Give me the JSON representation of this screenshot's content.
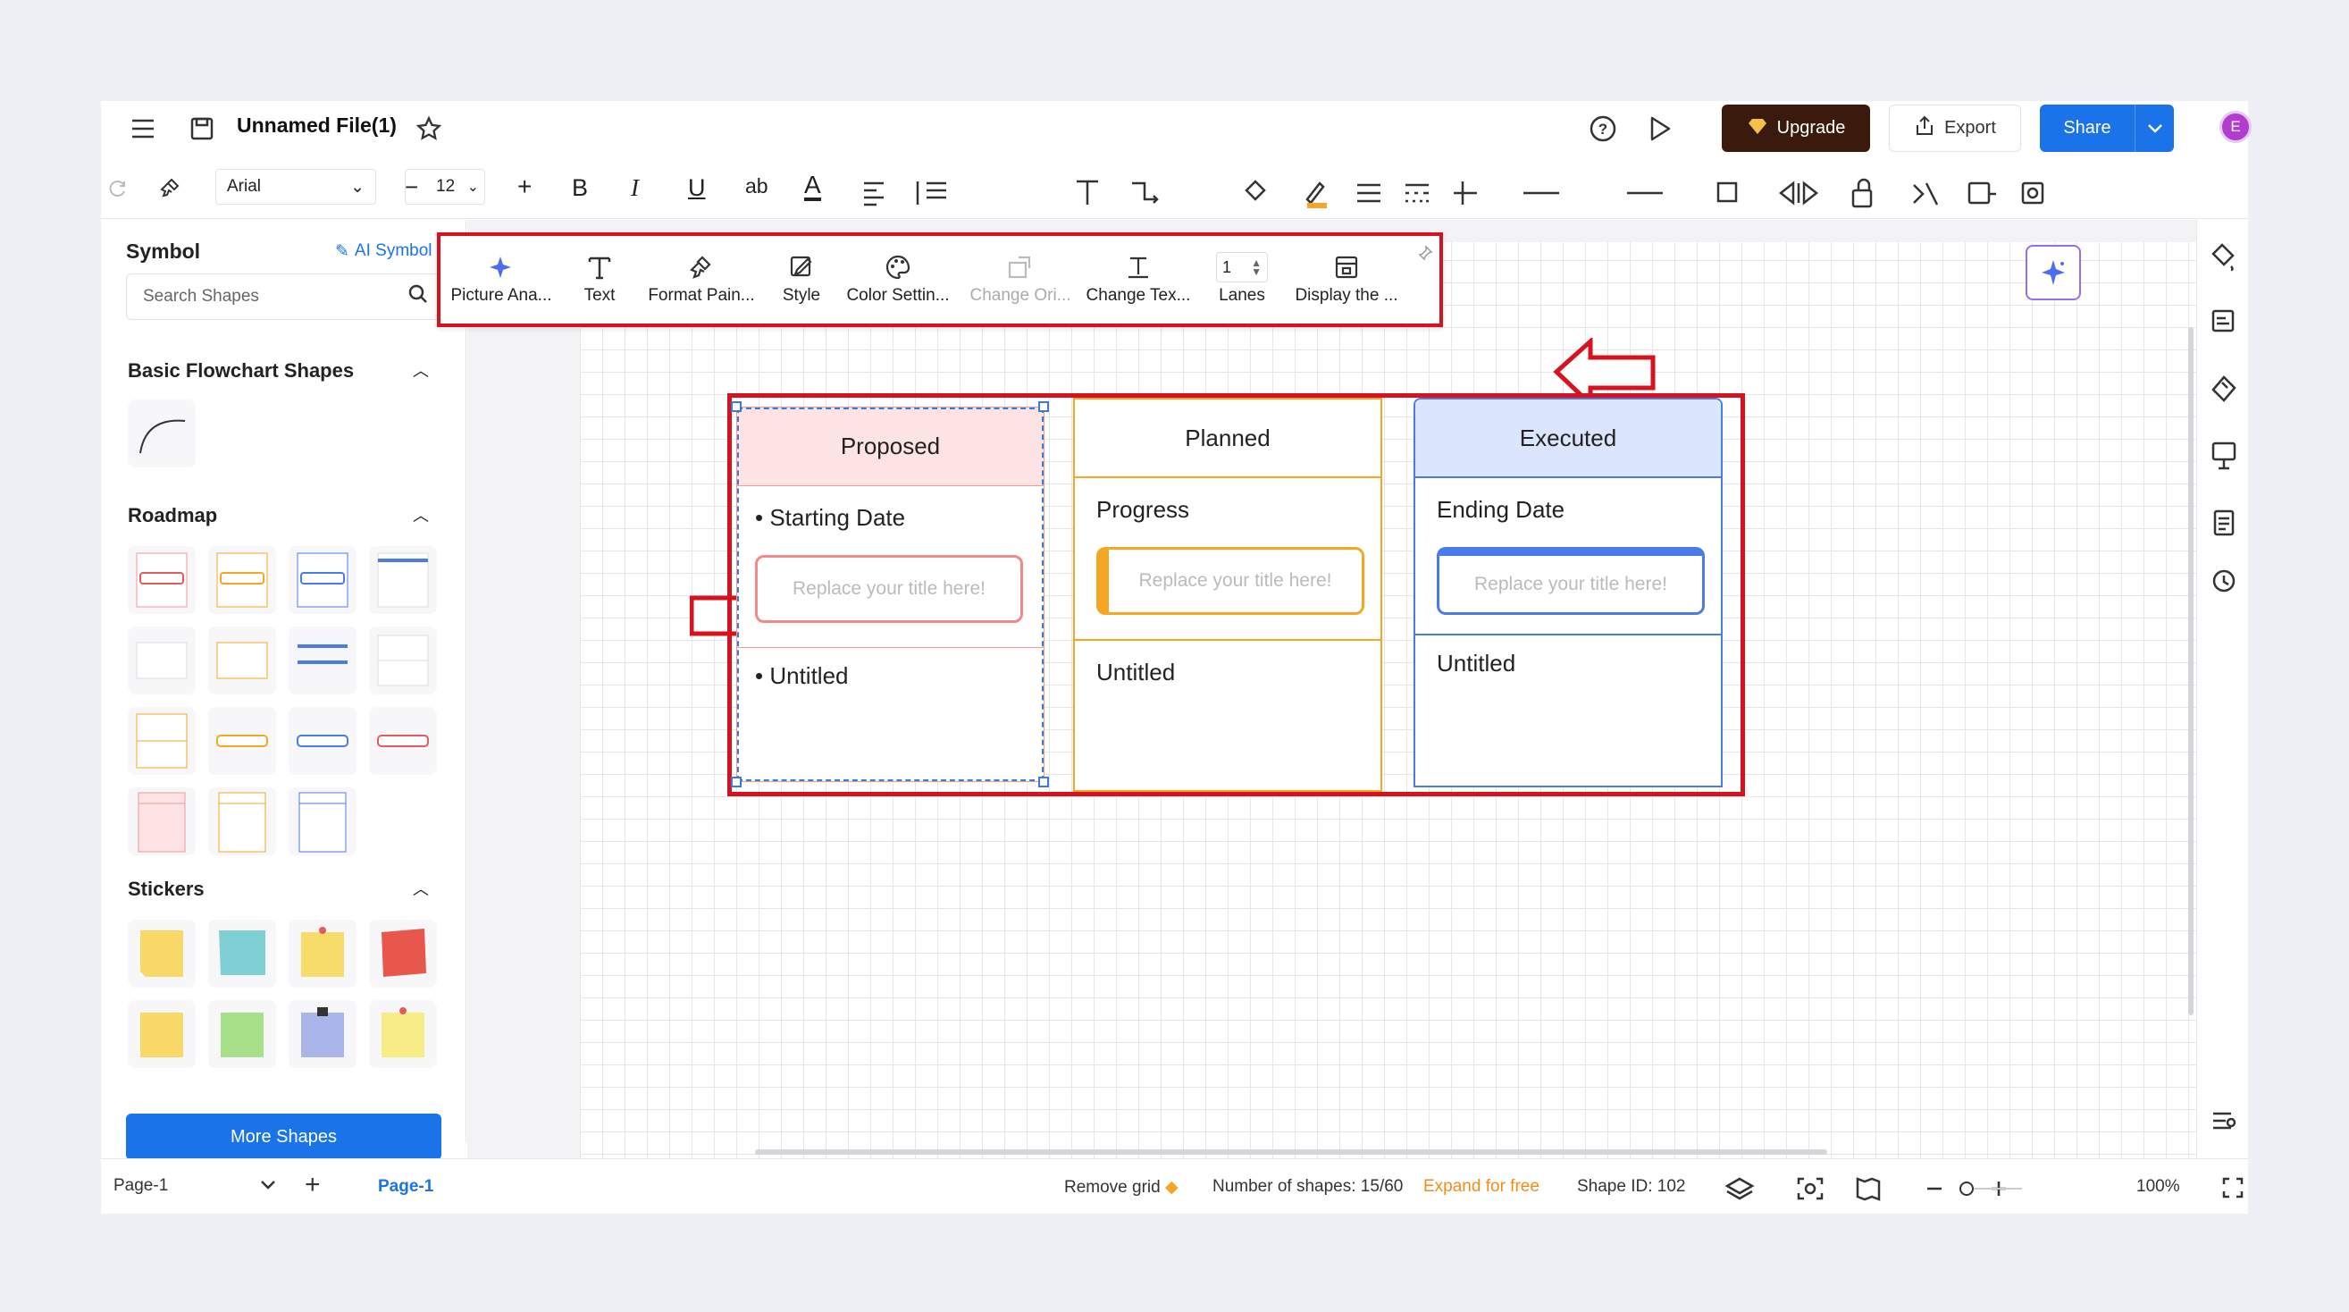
{
  "header": {
    "file_title": "Unnamed File(1)",
    "upgrade_label": "Upgrade",
    "export_label": "Export",
    "share_label": "Share",
    "avatar_letter": "E"
  },
  "toolbar": {
    "font_family": "Arial",
    "font_size": "12",
    "bold": "B",
    "italic": "I",
    "underline": "U",
    "strike": "ab",
    "text_color": "A"
  },
  "left_panel": {
    "symbol_title": "Symbol",
    "ai_symbol_label": "AI Symbol",
    "search_placeholder": "Search Shapes",
    "section_basic": "Basic Flowchart Shapes",
    "section_roadmap": "Roadmap",
    "section_stickers": "Stickers",
    "more_shapes_label": "More Shapes"
  },
  "floating_toolbar": {
    "items": [
      {
        "label": "Picture Ana...",
        "icon": "sparkle-icon"
      },
      {
        "label": "Text",
        "icon": "text-icon"
      },
      {
        "label": "Format Pain...",
        "icon": "format-painter-icon"
      },
      {
        "label": "Style",
        "icon": "style-icon"
      },
      {
        "label": "Color Settin...",
        "icon": "palette-icon"
      },
      {
        "label": "Change Ori...",
        "icon": "orientation-icon"
      },
      {
        "label": "Change Tex...",
        "icon": "change-text-icon"
      },
      {
        "label": "Lanes",
        "icon": "stepper-icon"
      },
      {
        "label": "Display the ...",
        "icon": "display-icon"
      }
    ],
    "lanes_value": "1"
  },
  "table": {
    "columns": [
      {
        "header": "Proposed",
        "row1": "Starting Date",
        "placeholder": "Replace your title here!",
        "row2": "Untitled",
        "accent": "#f08a8a",
        "header_bg": "#fde3e3"
      },
      {
        "header": "Planned",
        "row1": "Progress",
        "placeholder": "Replace your title here!",
        "row2": "Untitled",
        "accent": "#f5a623",
        "header_bg": "#ffffff"
      },
      {
        "header": "Executed",
        "row1": "Ending Date",
        "placeholder": "Replace your title here!",
        "row2": "Untitled",
        "accent": "#4a7bea",
        "header_bg": "#dbe5fb"
      }
    ]
  },
  "statusbar": {
    "page_select": "Page-1",
    "page_tab": "Page-1",
    "remove_grid": "Remove grid",
    "shapes_count": "Number of shapes: 15/60",
    "expand_label": "Expand for free",
    "shape_id": "Shape ID: 102",
    "zoom": "100%"
  },
  "colors": {
    "accent_blue": "#1a73e8",
    "highlight_red": "#d7121e",
    "upgrade_bg": "#3a1a0c"
  }
}
